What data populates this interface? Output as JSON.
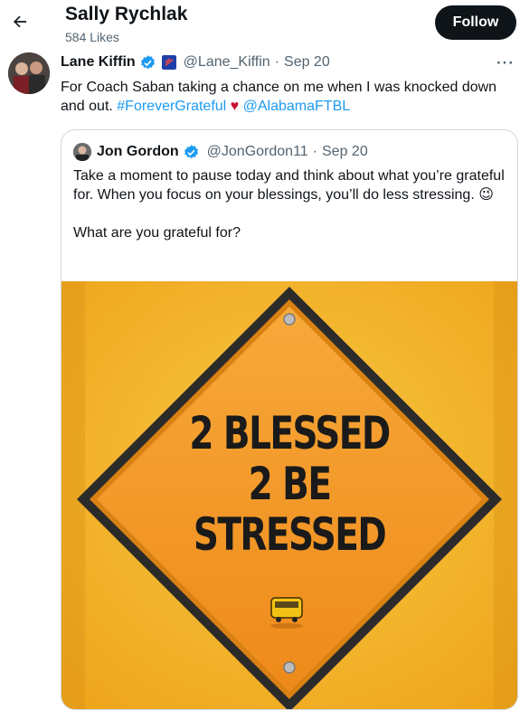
{
  "header": {
    "title": "Sally Rychlak",
    "subtitle": "584 Likes",
    "follow_label": "Follow",
    "back_icon": "arrow-left-icon"
  },
  "tweet": {
    "author_name": "Lane Kiffin",
    "handle": "@Lane_Kiffin",
    "dot": "·",
    "date": "Sep 20",
    "more_label": "···",
    "text_plain": "For Coach Saban taking a chance on me when I was knocked down and out.",
    "hashtag": "#ForeverGrateful",
    "heart": "♥",
    "mention": "@AlabamaFTBL",
    "colors": {
      "link": "#1d9bf0",
      "heart": "#c8102e",
      "verified": "#1d9bf0",
      "badge": "#1e3fa8"
    }
  },
  "quote": {
    "author_name": "Jon Gordon",
    "handle": "@JonGordon11",
    "dot": "·",
    "date": "Sep 20",
    "text_p1": "Take a moment to pause today and think about what you’re grateful for. When you focus on your blessings, you’ll do less stressing. 😉",
    "text_p2": "What are you grateful for?",
    "image": {
      "line1": "2 BLESSED",
      "line2": "2 BE",
      "line3": "STRESSED",
      "colors": {
        "sign": "#f39a24",
        "background": "#f5b82a",
        "border": "#2b2b2b"
      }
    }
  }
}
